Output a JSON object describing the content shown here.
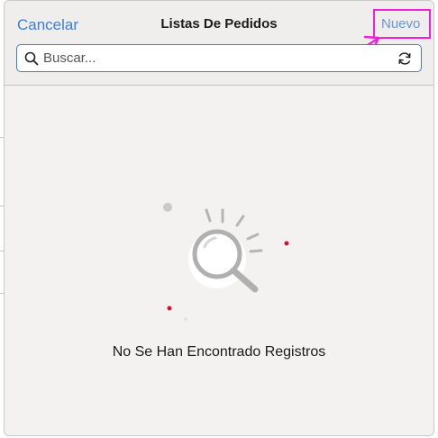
{
  "modal": {
    "title": "Listas De Pedidos",
    "cancel_label": "Cancelar",
    "new_label": "Nuevo"
  },
  "search": {
    "placeholder": "Buscar...",
    "value": "",
    "icon": "search-icon",
    "refresh_icon": "refresh-icon"
  },
  "empty_state": {
    "message": "No Se Han Encontrado Registros",
    "icon": "magnifier-illustration"
  },
  "colors": {
    "accent": "#3f7fd1",
    "highlight": "#f020d8",
    "dot_red": "#d3123a"
  }
}
